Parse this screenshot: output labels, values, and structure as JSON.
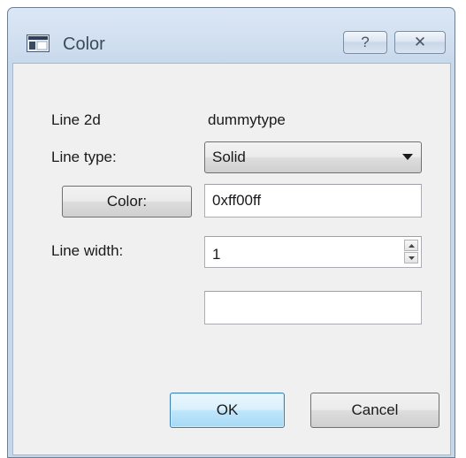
{
  "window": {
    "title": "Color",
    "help_glyph": "?",
    "close_glyph": "✕"
  },
  "form": {
    "line2d_label": "Line 2d",
    "line2d_value": "dummytype",
    "line_type_label": "Line type:",
    "line_type_value": "Solid",
    "color_button_label": "Color:",
    "color_value": "0xff00ff",
    "line_width_label": "Line width:",
    "line_width_value": "1",
    "extra_field_value": ""
  },
  "buttons": {
    "ok_label": "OK",
    "cancel_label": "Cancel"
  },
  "icons": {
    "app": "window-app-icon",
    "help": "help-icon",
    "close": "close-icon",
    "dropdown": "chevron-down-icon",
    "spin_up": "spin-up-icon",
    "spin_down": "spin-down-icon"
  },
  "colors": {
    "ok_button_border": "#3c7fb1",
    "title_text": "#3d4a5a"
  }
}
